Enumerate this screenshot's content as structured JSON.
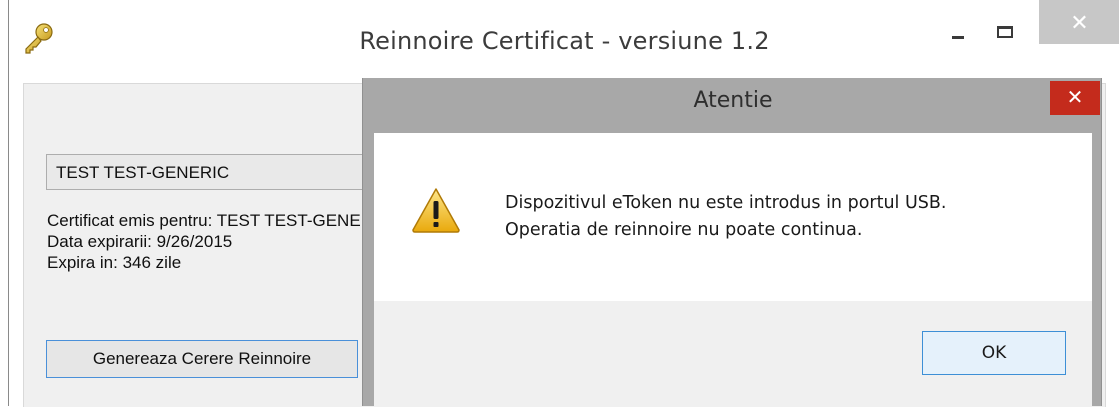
{
  "main_window": {
    "title": "Reinnoire Certificat - versiune 1.2",
    "icons": {
      "app": "key-icon",
      "minimize": "minimize-icon",
      "maximize": "maximize-icon",
      "close": "close-icon"
    },
    "close_glyph": "✕"
  },
  "certificate": {
    "selected": "TEST TEST-GENERIC",
    "issued_for": "Certificat emis pentru: TEST TEST-GENERIC",
    "expiry_date": "Data expirarii: 9/26/2015",
    "expires_in": "Expira in: 346 zile"
  },
  "actions": {
    "generate_renewal": "Genereaza Cerere Reinnoire"
  },
  "dialog": {
    "title": "Atentie",
    "close_glyph": "✕",
    "icon": "warning-icon",
    "message_line1": "Dispozitivul eToken nu este introdus in portul USB.",
    "message_line2": "Operatia de reinnoire nu poate continua.",
    "ok_label": "OK"
  },
  "colors": {
    "dialog_close": "#c42b1c",
    "warning_yellow": "#f2c12e",
    "focus_border": "#3d8fd6"
  }
}
